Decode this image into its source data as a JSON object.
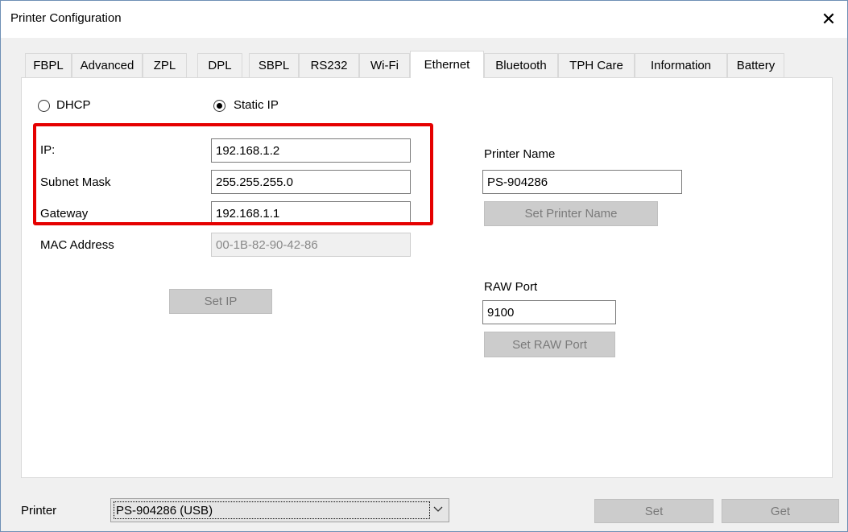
{
  "window": {
    "title": "Printer Configuration",
    "close_glyph": "✕"
  },
  "tabs": [
    "FBPL",
    "Advanced",
    "ZPL",
    "DPL",
    "SBPL",
    "RS232",
    "Wi-Fi",
    "Ethernet",
    "Bluetooth",
    "TPH Care",
    "Information",
    "Battery"
  ],
  "active_tab": "Ethernet",
  "ethernet": {
    "dhcp_label": "DHCP",
    "static_label": "Static IP",
    "selected_mode": "Static IP",
    "ip_label": "IP:",
    "ip_value": "192.168.1.2",
    "subnet_label": "Subnet Mask",
    "subnet_value": "255.255.255.0",
    "gateway_label": "Gateway",
    "gateway_value": "192.168.1.1",
    "mac_label": "MAC Address",
    "mac_value": "00-1B-82-90-42-86",
    "set_ip_label": "Set IP",
    "printer_name_label": "Printer Name",
    "printer_name_value": "PS-904286",
    "set_printer_name_label": "Set Printer Name",
    "raw_port_label": "RAW Port",
    "raw_port_value": "9100",
    "set_raw_port_label": "Set RAW Port"
  },
  "footer": {
    "printer_label": "Printer",
    "printer_selected": "PS-904286 (USB)",
    "set_label": "Set",
    "get_label": "Get"
  },
  "colors": {
    "highlight": "#e50000",
    "window_bg": "#f0f0f0",
    "disabled_button": "#cccccc"
  },
  "icons": {
    "close": "close-icon",
    "dropdown": "chevron-down-icon"
  }
}
